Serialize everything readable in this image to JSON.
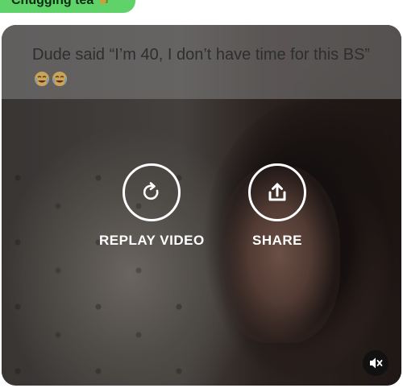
{
  "tag": {
    "label": "Chugging tea",
    "icon": "tea-icon",
    "color": "#5fd36a"
  },
  "post": {
    "caption": "Dude said “I’m 40, I don’t have time for this BS”",
    "emojis": [
      "crying-laughing-emoji",
      "crying-laughing-emoji"
    ]
  },
  "video_overlay": {
    "replay_label": "REPLAY VIDEO",
    "replay_icon": "replay-icon",
    "share_label": "SHARE",
    "share_icon": "share-icon",
    "mute_icon": "muted-speaker-icon"
  }
}
